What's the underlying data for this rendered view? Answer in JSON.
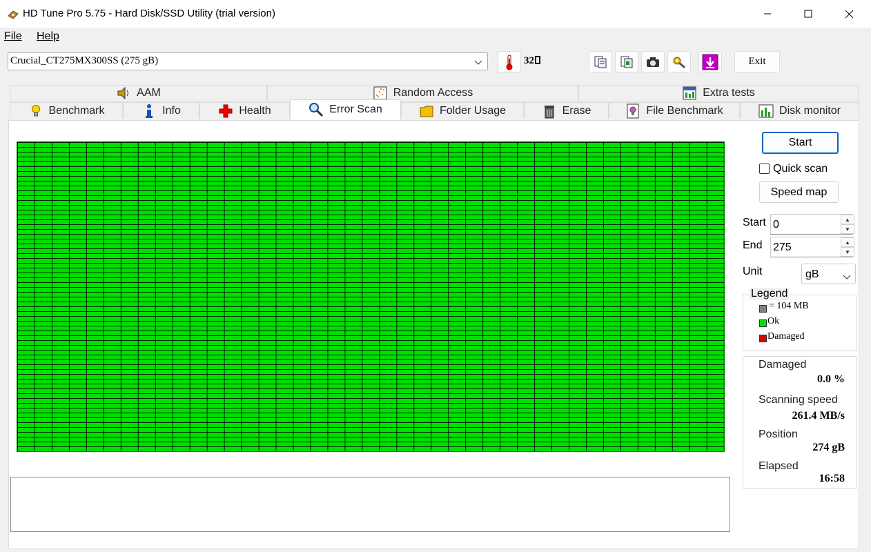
{
  "window": {
    "title": "HD Tune Pro 5.75 - Hard Disk/SSD Utility (trial version)"
  },
  "menu": {
    "file": "File",
    "help": "Help"
  },
  "toolbar": {
    "drive": "Crucial_CT275MX300SS (275 gB)",
    "temperature": "32",
    "exit_label": "Exit"
  },
  "tabs": {
    "row1": [
      "AAM",
      "Random Access",
      "Extra tests"
    ],
    "row2": [
      "Benchmark",
      "Info",
      "Health",
      "Error Scan",
      "Folder Usage",
      "Erase",
      "File Benchmark",
      "Disk monitor"
    ],
    "active": "Error Scan"
  },
  "scan": {
    "start_label": "Start",
    "quick_scan_label": "Quick scan",
    "quick_scan_checked": false,
    "speed_map_label": "Speed map",
    "start_field_label": "Start",
    "start_value": "0",
    "end_field_label": "End",
    "end_value": "275",
    "unit_label": "Unit",
    "unit_value": "gB",
    "grid_columns": 41,
    "grid_rows": 64,
    "ok_color": "#00e000"
  },
  "legend": {
    "title": "Legend",
    "block_size": "= 104 MB",
    "ok": "Ok",
    "damaged": "Damaged",
    "colors": {
      "block": "#808080",
      "ok": "#00e000",
      "damaged": "#e00000"
    }
  },
  "stats": {
    "damaged_label": "Damaged",
    "damaged_value": "0.0 %",
    "speed_label": "Scanning speed",
    "speed_value": "261.4 MB/s",
    "position_label": "Position",
    "position_value": "274 gB",
    "elapsed_label": "Elapsed",
    "elapsed_value": "16:58"
  }
}
